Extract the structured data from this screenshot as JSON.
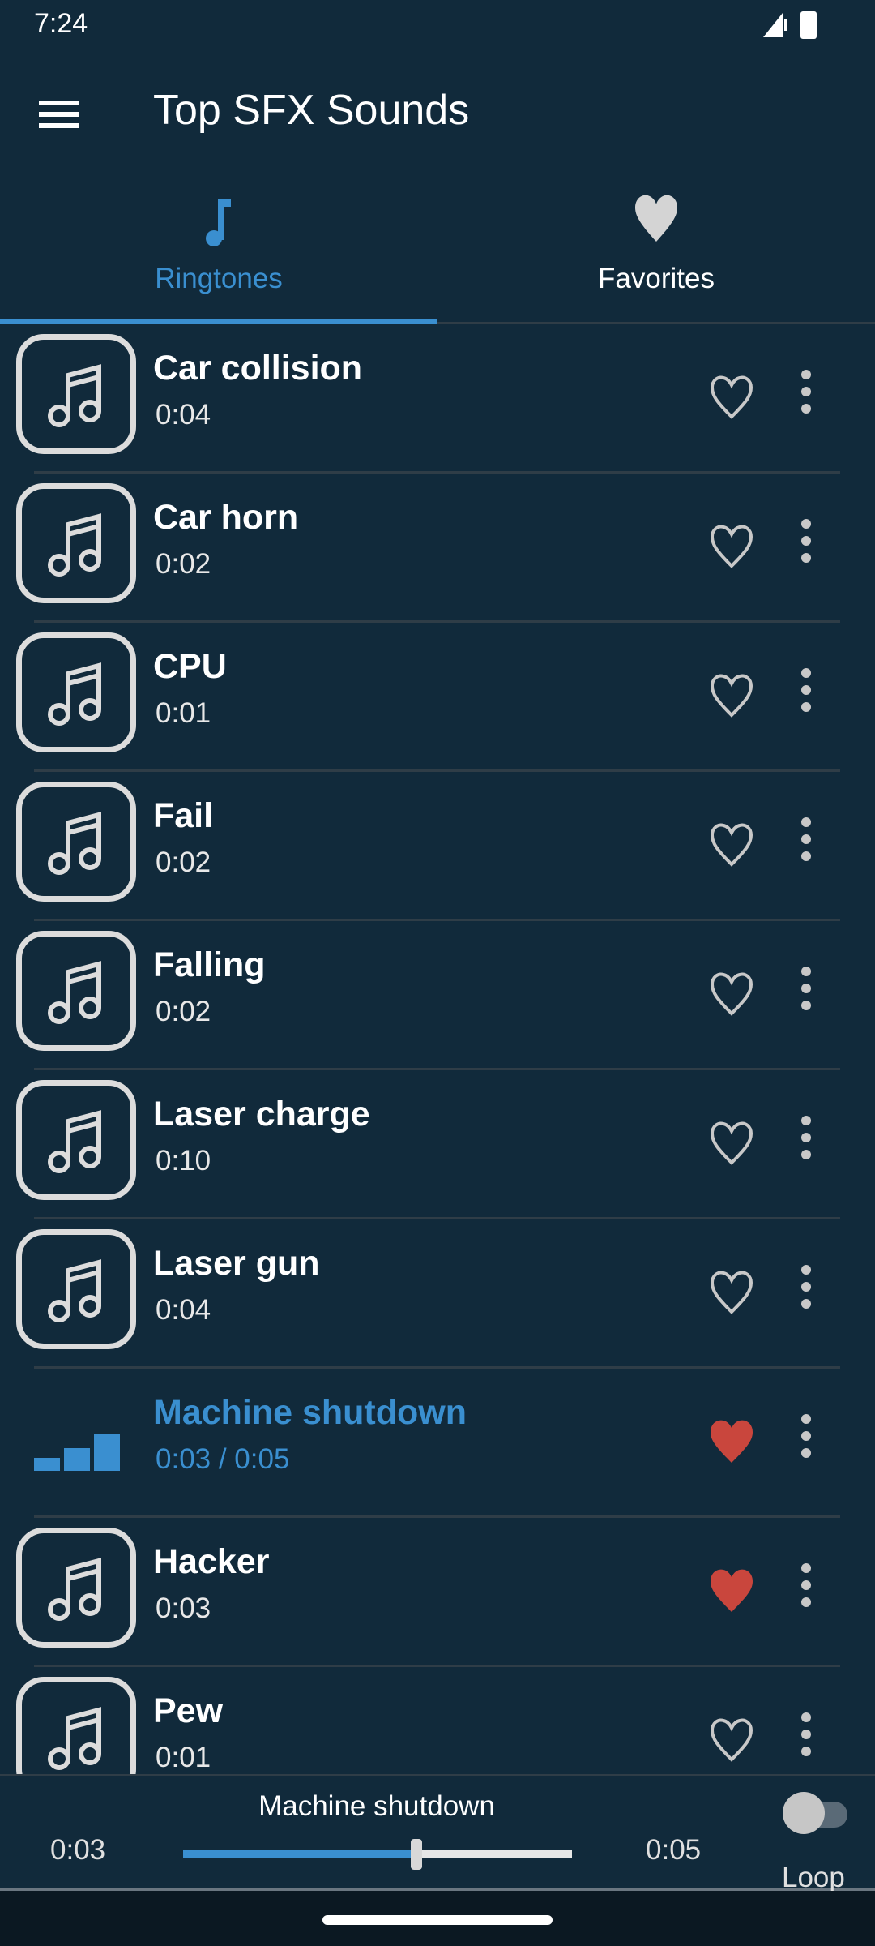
{
  "status_bar": {
    "time": "7:24"
  },
  "toolbar": {
    "title": "Top SFX Sounds",
    "menu_icon": "hamburger-menu-icon"
  },
  "tabs": [
    {
      "label": "Ringtones",
      "icon": "music-note-icon",
      "active": true
    },
    {
      "label": "Favorites",
      "icon": "heart-icon",
      "active": false
    }
  ],
  "colors": {
    "accent": "#3a8fd0",
    "favorite": "#c9463d",
    "background": "#112a3b"
  },
  "sounds": [
    {
      "name": "Car collision",
      "duration": "0:04",
      "favorite": false
    },
    {
      "name": "Car horn",
      "duration": "0:02",
      "favorite": false
    },
    {
      "name": "CPU",
      "duration": "0:01",
      "favorite": false
    },
    {
      "name": "Fail",
      "duration": "0:02",
      "favorite": false
    },
    {
      "name": "Falling",
      "duration": "0:02",
      "favorite": false
    },
    {
      "name": "Laser charge",
      "duration": "0:10",
      "favorite": false
    },
    {
      "name": "Laser gun",
      "duration": "0:04",
      "favorite": false
    },
    {
      "name": "Machine shutdown",
      "duration": "0:03 /  0:05",
      "favorite": true,
      "playing": true
    },
    {
      "name": "Hacker",
      "duration": "0:03",
      "favorite": true
    },
    {
      "name": "Pew",
      "duration": "0:01",
      "favorite": false
    }
  ],
  "player": {
    "title": "Machine shutdown",
    "current": "0:03",
    "total": "0:05",
    "progress": 0.6,
    "loop_label": "Loop",
    "loop_on": false
  }
}
